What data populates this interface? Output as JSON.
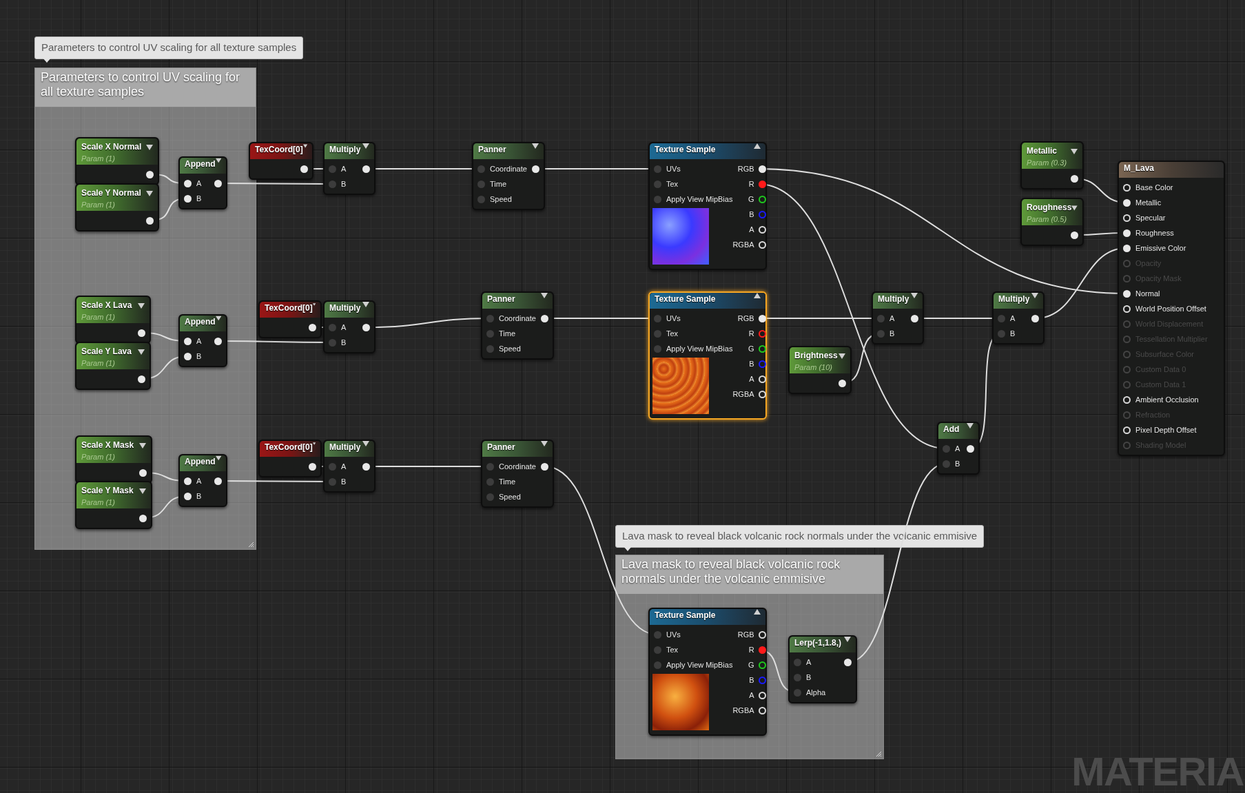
{
  "comments": [
    {
      "bubble": "Parameters to control UV scaling for all texture samples",
      "title": "Parameters to control UV scaling for all texture samples"
    },
    {
      "bubble": "Lava mask to reveal black volcanic rock normals under the volcanic emmisive",
      "title": "Lava mask to reveal black volcanic rock normals under the volcanic emmisive"
    }
  ],
  "nodes": [
    {
      "kind": "param",
      "title": "Scale X Normal",
      "subtitle": "Param (1)",
      "selected": false,
      "outputs": [
        {
          "filled": true
        }
      ]
    },
    {
      "kind": "param",
      "title": "Scale Y Normal",
      "subtitle": "Param (1)",
      "selected": false,
      "outputs": [
        {
          "filled": true
        }
      ]
    },
    {
      "kind": "function",
      "title": "Append",
      "selected": false,
      "inputs": [
        {
          "label": "A",
          "filled": true
        },
        {
          "label": "B",
          "filled": true
        }
      ],
      "outputs": [
        {
          "filled": true
        }
      ]
    },
    {
      "kind": "texcoord",
      "title": "TexCoord[0]",
      "selected": false,
      "outputs": [
        {
          "filled": true
        }
      ]
    },
    {
      "kind": "function",
      "title": "Multiply",
      "selected": false,
      "inputs": [
        {
          "label": "A",
          "filled": false
        },
        {
          "label": "B",
          "filled": false
        }
      ],
      "outputs": [
        {
          "filled": true
        }
      ]
    },
    {
      "kind": "function",
      "title": "Panner",
      "selected": false,
      "inputs": [
        {
          "label": "Coordinate",
          "filled": false
        },
        {
          "label": "Time",
          "filled": false
        },
        {
          "label": "Speed",
          "filled": false
        }
      ],
      "outputs": [
        {
          "filled": true
        }
      ]
    },
    {
      "kind": "texture",
      "title": "Texture Sample",
      "preview": {
        "kind": "normal"
      },
      "selected": false,
      "inputs": [
        {
          "label": "UVs",
          "filled": false
        },
        {
          "label": "Tex",
          "filled": false
        },
        {
          "label": "Apply View MipBias",
          "filled": false
        }
      ],
      "outputs": [
        {
          "label": "RGB",
          "filled": true
        },
        {
          "label": "R",
          "filled": true,
          "color": "#ff1a1a"
        },
        {
          "label": "G",
          "filled": false,
          "color": "#1ec81e"
        },
        {
          "label": "B",
          "filled": false,
          "color": "#1a1aff"
        },
        {
          "label": "A",
          "filled": false
        },
        {
          "label": "RGBA",
          "filled": false
        }
      ]
    },
    {
      "kind": "param",
      "title": "Metallic",
      "subtitle": "Param (0.3)",
      "selected": false,
      "outputs": [
        {
          "filled": true
        }
      ]
    },
    {
      "kind": "param",
      "title": "Roughness",
      "subtitle": "Param (0.5)",
      "selected": false,
      "outputs": [
        {
          "filled": true
        }
      ]
    },
    {
      "kind": "output",
      "title": "M_Lava",
      "selected": false,
      "inputs": [
        {
          "label": "Base Color",
          "filled": false,
          "disabled": false
        },
        {
          "label": "Metallic",
          "filled": true,
          "disabled": false
        },
        {
          "label": "Specular",
          "filled": false,
          "disabled": false
        },
        {
          "label": "Roughness",
          "filled": true,
          "disabled": false
        },
        {
          "label": "Emissive Color",
          "filled": true,
          "disabled": false
        },
        {
          "label": "Opacity",
          "filled": false,
          "disabled": true
        },
        {
          "label": "Opacity Mask",
          "filled": false,
          "disabled": true
        },
        {
          "label": "Normal",
          "filled": true,
          "disabled": false
        },
        {
          "label": "World Position Offset",
          "filled": false,
          "disabled": false
        },
        {
          "label": "World Displacement",
          "filled": false,
          "disabled": true
        },
        {
          "label": "Tessellation Multiplier",
          "filled": false,
          "disabled": true
        },
        {
          "label": "Subsurface Color",
          "filled": false,
          "disabled": true
        },
        {
          "label": "Custom Data 0",
          "filled": false,
          "disabled": true
        },
        {
          "label": "Custom Data 1",
          "filled": false,
          "disabled": true
        },
        {
          "label": "Ambient Occlusion",
          "filled": false,
          "disabled": false
        },
        {
          "label": "Refraction",
          "filled": false,
          "disabled": true
        },
        {
          "label": "Pixel Depth Offset",
          "filled": false,
          "disabled": false
        },
        {
          "label": "Shading Model",
          "filled": false,
          "disabled": true
        }
      ]
    },
    {
      "kind": "param",
      "title": "Scale X Lava",
      "subtitle": "Param (1)",
      "selected": false,
      "outputs": [
        {
          "filled": true
        }
      ]
    },
    {
      "kind": "param",
      "title": "Scale Y Lava",
      "subtitle": "Param (1)",
      "selected": false,
      "outputs": [
        {
          "filled": true
        }
      ]
    },
    {
      "kind": "function",
      "title": "Append",
      "selected": false,
      "inputs": [
        {
          "label": "A",
          "filled": true
        },
        {
          "label": "B",
          "filled": true
        }
      ],
      "outputs": [
        {
          "filled": true
        }
      ]
    },
    {
      "kind": "texcoord",
      "title": "TexCoord[0]",
      "selected": false,
      "outputs": [
        {
          "filled": true
        }
      ]
    },
    {
      "kind": "function",
      "title": "Multiply",
      "selected": false,
      "inputs": [
        {
          "label": "A",
          "filled": false
        },
        {
          "label": "B",
          "filled": false
        }
      ],
      "outputs": [
        {
          "filled": true
        }
      ]
    },
    {
      "kind": "function",
      "title": "Panner",
      "selected": false,
      "inputs": [
        {
          "label": "Coordinate",
          "filled": false
        },
        {
          "label": "Time",
          "filled": false
        },
        {
          "label": "Speed",
          "filled": false
        }
      ],
      "outputs": [
        {
          "filled": true
        }
      ]
    },
    {
      "kind": "texture",
      "title": "Texture Sample",
      "preview": {
        "kind": "lava"
      },
      "selected": true,
      "inputs": [
        {
          "label": "UVs",
          "filled": false
        },
        {
          "label": "Tex",
          "filled": false
        },
        {
          "label": "Apply View MipBias",
          "filled": false
        }
      ],
      "outputs": [
        {
          "label": "RGB",
          "filled": true
        },
        {
          "label": "R",
          "filled": false,
          "color": "#ff1a1a"
        },
        {
          "label": "G",
          "filled": false,
          "color": "#1ec81e"
        },
        {
          "label": "B",
          "filled": false,
          "color": "#1a1aff"
        },
        {
          "label": "A",
          "filled": false
        },
        {
          "label": "RGBA",
          "filled": false
        }
      ]
    },
    {
      "kind": "param",
      "title": "Brightness",
      "subtitle": "Param (10)",
      "selected": false,
      "outputs": [
        {
          "filled": true
        }
      ]
    },
    {
      "kind": "function",
      "title": "Multiply",
      "selected": false,
      "inputs": [
        {
          "label": "A",
          "filled": false
        },
        {
          "label": "B",
          "filled": false
        }
      ],
      "outputs": [
        {
          "filled": true
        }
      ]
    },
    {
      "kind": "function",
      "title": "Multiply",
      "selected": false,
      "inputs": [
        {
          "label": "A",
          "filled": false
        },
        {
          "label": "B",
          "filled": false
        }
      ],
      "outputs": [
        {
          "filled": true
        }
      ]
    },
    {
      "kind": "function",
      "title": "Add",
      "selected": false,
      "inputs": [
        {
          "label": "A",
          "filled": false
        },
        {
          "label": "B",
          "filled": false
        }
      ],
      "outputs": [
        {
          "filled": true
        }
      ]
    },
    {
      "kind": "param",
      "title": "Scale X Mask",
      "subtitle": "Param (1)",
      "selected": false,
      "outputs": [
        {
          "filled": true
        }
      ]
    },
    {
      "kind": "param",
      "title": "Scale Y Mask",
      "subtitle": "Param (1)",
      "selected": false,
      "outputs": [
        {
          "filled": true
        }
      ]
    },
    {
      "kind": "function",
      "title": "Append",
      "selected": false,
      "inputs": [
        {
          "label": "A",
          "filled": true
        },
        {
          "label": "B",
          "filled": true
        }
      ],
      "outputs": [
        {
          "filled": true
        }
      ]
    },
    {
      "kind": "texcoord",
      "title": "TexCoord[0]",
      "selected": false,
      "outputs": [
        {
          "filled": true
        }
      ]
    },
    {
      "kind": "function",
      "title": "Multiply",
      "selected": false,
      "inputs": [
        {
          "label": "A",
          "filled": false
        },
        {
          "label": "B",
          "filled": false
        }
      ],
      "outputs": [
        {
          "filled": true
        }
      ]
    },
    {
      "kind": "function",
      "title": "Panner",
      "selected": false,
      "inputs": [
        {
          "label": "Coordinate",
          "filled": false
        },
        {
          "label": "Time",
          "filled": false
        },
        {
          "label": "Speed",
          "filled": false
        }
      ],
      "outputs": [
        {
          "filled": true
        }
      ]
    },
    {
      "kind": "texture",
      "title": "Texture Sample",
      "preview": {
        "kind": "fire"
      },
      "selected": false,
      "inputs": [
        {
          "label": "UVs",
          "filled": false
        },
        {
          "label": "Tex",
          "filled": false
        },
        {
          "label": "Apply View MipBias",
          "filled": false
        }
      ],
      "outputs": [
        {
          "label": "RGB",
          "filled": false
        },
        {
          "label": "R",
          "filled": true,
          "color": "#ff1a1a"
        },
        {
          "label": "G",
          "filled": false,
          "color": "#1ec81e"
        },
        {
          "label": "B",
          "filled": false,
          "color": "#1a1aff"
        },
        {
          "label": "A",
          "filled": false
        },
        {
          "label": "RGBA",
          "filled": false
        }
      ]
    },
    {
      "kind": "function",
      "title": "Lerp(-1,1.8,)",
      "selected": false,
      "inputs": [
        {
          "label": "A",
          "filled": false
        },
        {
          "label": "B",
          "filled": false
        },
        {
          "label": "Alpha",
          "filled": false
        }
      ],
      "outputs": [
        {
          "filled": true
        }
      ]
    }
  ],
  "watermark": "MATERIA"
}
